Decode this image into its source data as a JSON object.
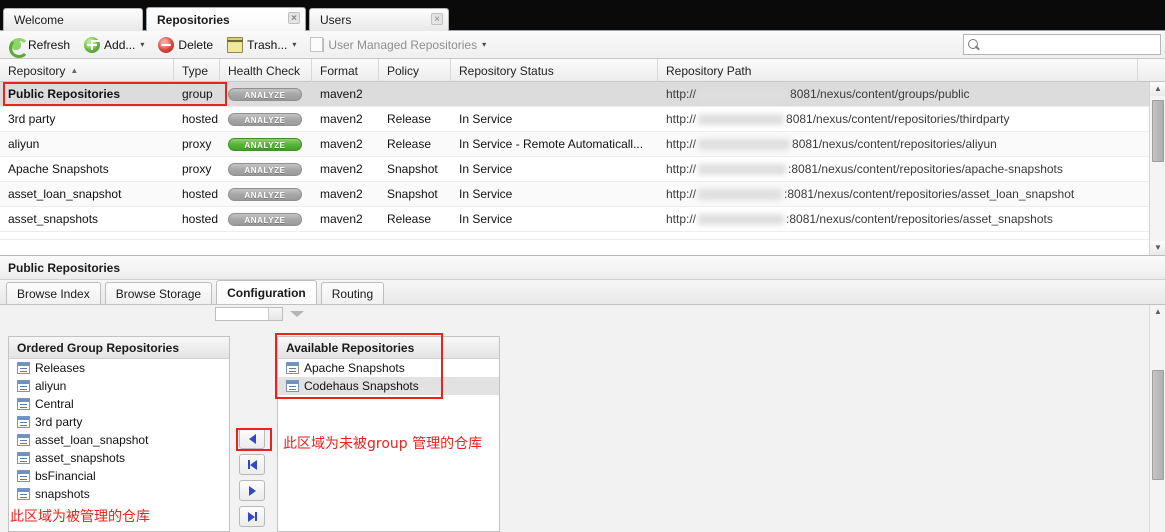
{
  "window": {
    "tabs": [
      {
        "label": "Welcome",
        "active": false,
        "closable": false
      },
      {
        "label": "Repositories",
        "active": true,
        "closable": true
      },
      {
        "label": "Users",
        "active": false,
        "closable": true
      }
    ],
    "close_glyph": "×"
  },
  "toolbar": {
    "refresh_label": "Refresh",
    "add_label": "Add...",
    "delete_label": "Delete",
    "trash_label": "Trash...",
    "user_managed_label": "User Managed Repositories",
    "caret_glyph": "▾",
    "search_value": "",
    "search_placeholder": ""
  },
  "grid": {
    "columns": [
      {
        "label": "Repository",
        "sorted": true,
        "sort_glyph": "▲"
      },
      {
        "label": "Type"
      },
      {
        "label": "Health Check"
      },
      {
        "label": "Format"
      },
      {
        "label": "Policy"
      },
      {
        "label": "Repository Status"
      },
      {
        "label": "Repository Path"
      }
    ],
    "badge_label": "ANALYZE",
    "rows": [
      {
        "repository": "Public Repositories",
        "type": "group",
        "health": "ANALYZE",
        "health_state": "disabled",
        "format": "maven2",
        "policy": "",
        "status": "",
        "path_prefix": "http://",
        "path_suffix": "8081/nexus/content/groups/public",
        "selected": true
      },
      {
        "repository": "3rd party",
        "type": "hosted",
        "health": "ANALYZE",
        "health_state": "disabled",
        "format": "maven2",
        "policy": "Release",
        "status": "In Service",
        "path_prefix": "http://",
        "path_suffix": "8081/nexus/content/repositories/thirdparty",
        "selected": false
      },
      {
        "repository": "aliyun",
        "type": "proxy",
        "health": "ANALYZE",
        "health_state": "active",
        "format": "maven2",
        "policy": "Release",
        "status": "In Service - Remote Automaticall...",
        "path_prefix": "http://",
        "path_suffix": "8081/nexus/content/repositories/aliyun",
        "selected": false
      },
      {
        "repository": "Apache Snapshots",
        "type": "proxy",
        "health": "ANALYZE",
        "health_state": "disabled",
        "format": "maven2",
        "policy": "Snapshot",
        "status": "In Service",
        "path_prefix": "http://",
        "path_suffix": ":8081/nexus/content/repositories/apache-snapshots",
        "selected": false
      },
      {
        "repository": "asset_loan_snapshot",
        "type": "hosted",
        "health": "ANALYZE",
        "health_state": "disabled",
        "format": "maven2",
        "policy": "Snapshot",
        "status": "In Service",
        "path_prefix": "http://",
        "path_suffix": ":8081/nexus/content/repositories/asset_loan_snapshot",
        "selected": false
      },
      {
        "repository": "asset_snapshots",
        "type": "hosted",
        "health": "ANALYZE",
        "health_state": "disabled",
        "format": "maven2",
        "policy": "Release",
        "status": "In Service",
        "path_prefix": "http://",
        "path_suffix": ":8081/nexus/content/repositories/asset_snapshots",
        "selected": false
      }
    ]
  },
  "detail": {
    "title": "Public Repositories",
    "tabs": [
      {
        "label": "Browse Index",
        "active": false
      },
      {
        "label": "Browse Storage",
        "active": false
      },
      {
        "label": "Configuration",
        "active": true
      },
      {
        "label": "Routing",
        "active": false
      }
    ],
    "ordered_group": {
      "title": "Ordered Group Repositories",
      "items": [
        "Releases",
        "aliyun",
        "Central",
        "3rd party",
        "asset_loan_snapshot",
        "asset_snapshots",
        "bsFinancial",
        "snapshots"
      ]
    },
    "available": {
      "title": "Available Repositories",
      "items": [
        "Apache Snapshots",
        "Codehaus Snapshots"
      ]
    },
    "transfer_buttons": [
      {
        "name": "move-left",
        "glyph": "◀"
      },
      {
        "name": "move-all-left",
        "glyph": "▎◀"
      },
      {
        "name": "move-right",
        "glyph": "▶"
      },
      {
        "name": "move-all-right",
        "glyph": "▶▎"
      }
    ]
  },
  "annotations": {
    "left_note": "此区域为被管理的仓库",
    "right_note": "此区域为未被group 管理的仓库",
    "highlight_color": "#e8231d"
  },
  "scroll": {
    "up_glyph": "▲",
    "down_glyph": "▼"
  }
}
